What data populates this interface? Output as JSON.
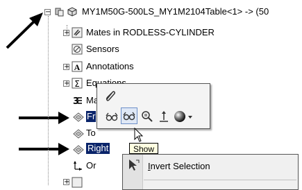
{
  "tree": {
    "root_label": "MY1M50G-500LS_MY1M2104Table<1> -> (50",
    "items": [
      {
        "label": "Mates in RODLESS-CYLINDER",
        "icon": "mates-icon"
      },
      {
        "label": "Sensors",
        "icon": "sensor-icon"
      },
      {
        "label": "Annotations",
        "icon": "annotations-icon"
      },
      {
        "label": "Equations",
        "icon": "equations-icon"
      },
      {
        "label": "Ma",
        "icon": "material-icon"
      },
      {
        "label": "Fr",
        "icon": "plane-icon"
      },
      {
        "label": "To",
        "icon": "plane-icon"
      },
      {
        "label": "Right",
        "icon": "plane-icon"
      },
      {
        "label": "Or",
        "icon": "origin-icon"
      },
      {
        "label": "",
        "icon": "feature-icon"
      }
    ]
  },
  "context_toolbar": {
    "tooltip": "Show",
    "buttons": [
      "edit-icon",
      "hide-icon",
      "show-icon",
      "zoom-to-selection-icon",
      "normal-to-icon",
      "appearance-icon"
    ]
  },
  "context_menu": {
    "items": [
      {
        "label_html": "Invert Selection",
        "mnemonic": "I"
      }
    ]
  },
  "colors": {
    "selection": "#0a246a",
    "tooltip_bg": "#ffffe1"
  }
}
